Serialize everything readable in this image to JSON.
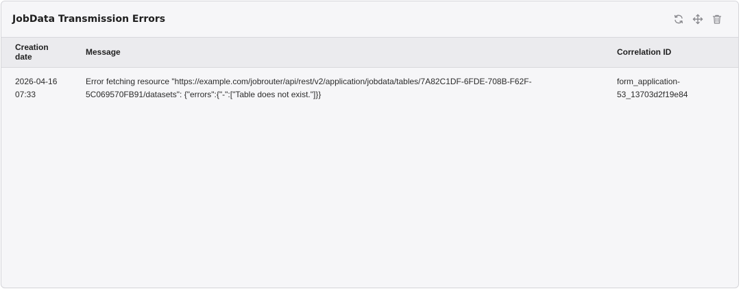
{
  "widget": {
    "title": "JobData Transmission Errors",
    "actions": [
      {
        "name": "refresh",
        "icon": "refresh-icon"
      },
      {
        "name": "move",
        "icon": "move-icon"
      },
      {
        "name": "delete",
        "icon": "trash-icon"
      }
    ]
  },
  "table": {
    "headers": {
      "creation_date": "Creation date",
      "message": "Message",
      "correlation_id": "Correlation ID"
    },
    "rows": [
      {
        "creation_date": "2026-04-16 07:33",
        "message": "Error fetching resource \"https://example.com/jobrouter/api/rest/v2/application/jobdata/tables/7A82C1DF-6FDE-708B-F62F-5C069570FB91/datasets\": {\"errors\":{\"-\":[\"Table does not exist.\"]}}",
        "correlation_id": "form_application-53_13703d2f19e84"
      }
    ]
  },
  "colors": {
    "background": "#f6f6f8",
    "header_row": "#ebebee",
    "border": "#d4d4d8",
    "icon": "#8a8a8f"
  }
}
